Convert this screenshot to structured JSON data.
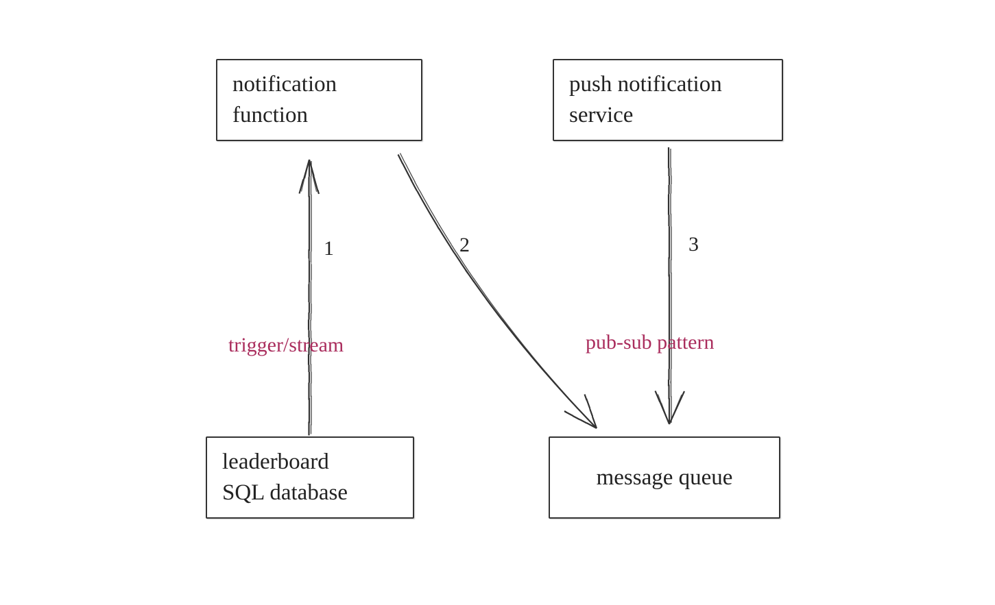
{
  "nodes": {
    "notification_function": {
      "line1": "notification",
      "line2": "function"
    },
    "push_service": {
      "line1": "push notification",
      "line2": "service"
    },
    "leaderboard_db": {
      "line1": "leaderboard",
      "line2": "SQL database"
    },
    "message_queue": {
      "line1": "message queue"
    }
  },
  "edges": {
    "e1": {
      "label": "1"
    },
    "e2": {
      "label": "2"
    },
    "e3": {
      "label": "3"
    }
  },
  "annotations": {
    "trigger_stream": "trigger/stream",
    "pubsub": "pub-sub pattern"
  },
  "colors": {
    "stroke": "#333333",
    "accent": "#aa2d5d"
  }
}
